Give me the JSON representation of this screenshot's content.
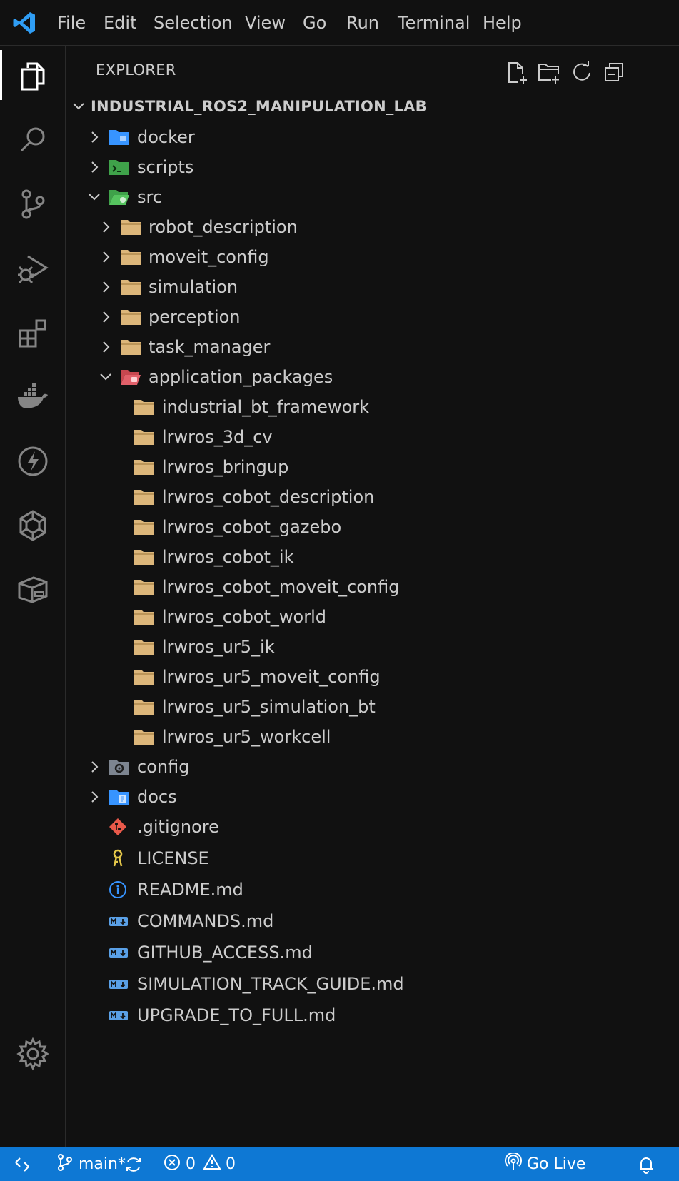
{
  "menu": [
    "File",
    "Edit",
    "Selection",
    "View",
    "Go",
    "Run",
    "Terminal",
    "Help"
  ],
  "activity_icons": [
    "explorer-icon",
    "search-icon",
    "source-control-icon",
    "run-debug-icon",
    "extensions-icon",
    "docker-icon",
    "thunder-client-icon",
    "ros-icon",
    "remote-containers-icon",
    "settings-gear-icon"
  ],
  "explorer": {
    "title": "EXPLORER",
    "toolbar_icons": [
      "new-file-icon",
      "new-folder-icon",
      "refresh-icon",
      "collapse-all-icon"
    ],
    "root": "INDUSTRIAL_ROS2_MANIPULATION_LAB",
    "items": {
      "docker": "docker",
      "scripts": "scripts",
      "src": "src",
      "robot_description": "robot_description",
      "moveit_config": "moveit_config",
      "simulation": "simulation",
      "perception": "perception",
      "task_manager": "task_manager",
      "application_packages": "application_packages",
      "industrial_bt_framework": "industrial_bt_framework",
      "lrwros_3d_cv": "lrwros_3d_cv",
      "lrwros_bringup": "lrwros_bringup",
      "lrwros_cobot_description": "lrwros_cobot_description",
      "lrwros_cobot_gazebo": "lrwros_cobot_gazebo",
      "lrwros_cobot_ik": "lrwros_cobot_ik",
      "lrwros_cobot_moveit_config": "lrwros_cobot_moveit_config",
      "lrwros_cobot_world": "lrwros_cobot_world",
      "lrwros_ur5_ik": "lrwros_ur5_ik",
      "lrwros_ur5_moveit_config": "lrwros_ur5_moveit_config",
      "lrwros_ur5_simulation_bt": "lrwros_ur5_simulation_bt",
      "lrwros_ur5_workcell": "lrwros_ur5_workcell",
      "config": "config",
      "docs": "docs",
      "gitignore": ".gitignore",
      "license": "LICENSE",
      "readme": "README.md",
      "commands": "COMMANDS.md",
      "github_access": "GITHUB_ACCESS.md",
      "simulation_track_guide": "SIMULATION_TRACK_GUIDE.md",
      "upgrade_to_full": "UPGRADE_TO_FULL.md"
    }
  },
  "status": {
    "branch": "main*",
    "errors": "0",
    "warnings": "0",
    "go_live": "Go Live"
  },
  "colors": {
    "background": "#111111",
    "statusbar": "#0e78d4",
    "folder": "#dcb67a",
    "accent_blue": "#3794ff"
  }
}
